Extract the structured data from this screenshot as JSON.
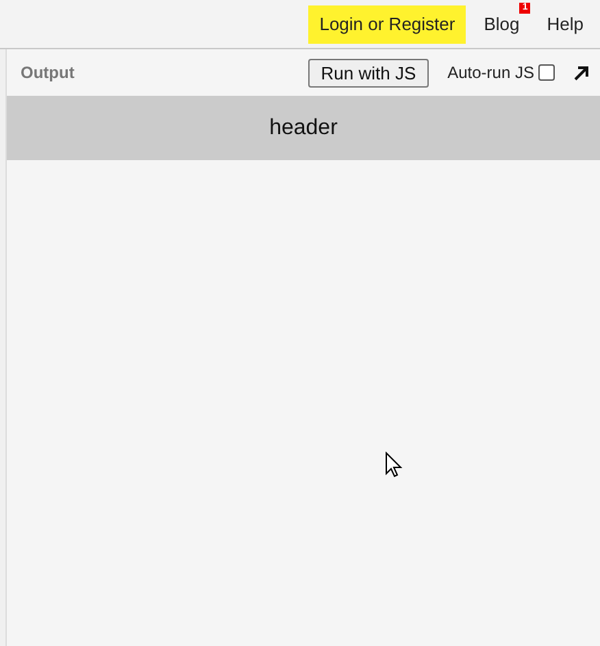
{
  "nav": {
    "login": "Login or Register",
    "blog": "Blog",
    "blog_badge": "1",
    "help": "Help"
  },
  "output": {
    "title": "Output",
    "run_button": "Run with JS",
    "autorun": {
      "label": "Auto-run JS",
      "checked": false
    }
  },
  "preview": {
    "header": "header"
  }
}
